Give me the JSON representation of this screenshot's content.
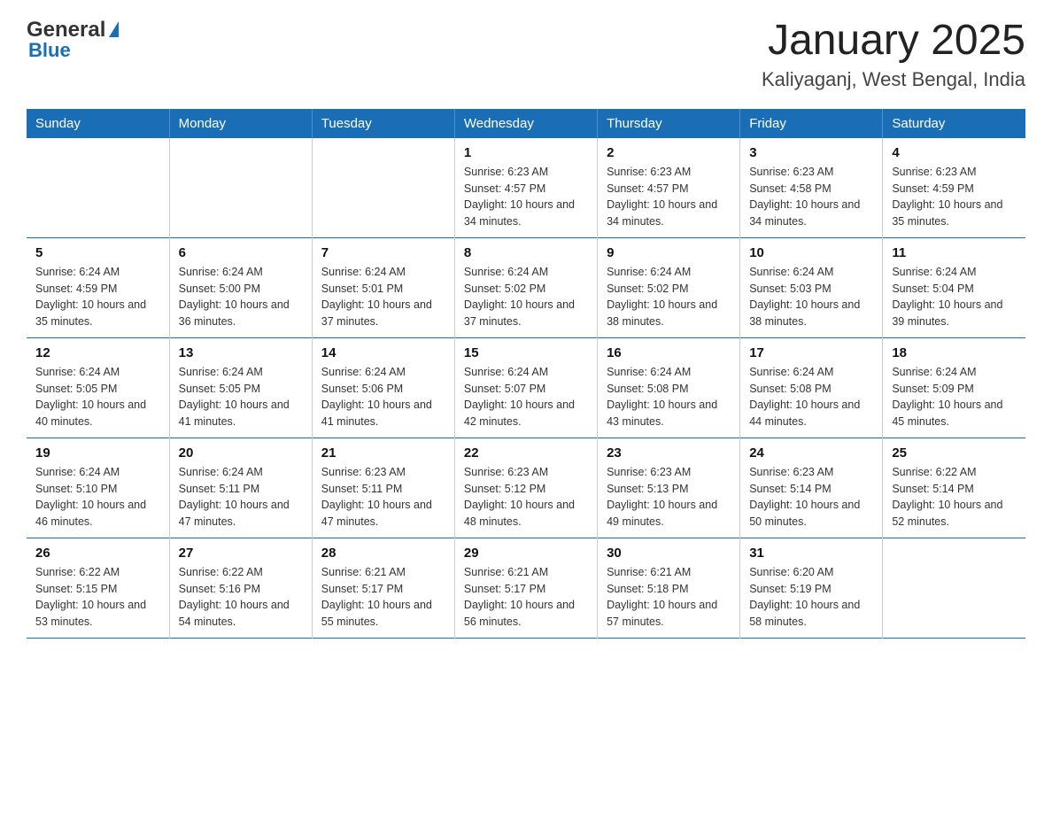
{
  "header": {
    "logo_general": "General",
    "logo_blue": "Blue",
    "title": "January 2025",
    "subtitle": "Kaliyaganj, West Bengal, India"
  },
  "days_of_week": [
    "Sunday",
    "Monday",
    "Tuesday",
    "Wednesday",
    "Thursday",
    "Friday",
    "Saturday"
  ],
  "weeks": [
    [
      {
        "day": "",
        "sunrise": "",
        "sunset": "",
        "daylight": ""
      },
      {
        "day": "",
        "sunrise": "",
        "sunset": "",
        "daylight": ""
      },
      {
        "day": "",
        "sunrise": "",
        "sunset": "",
        "daylight": ""
      },
      {
        "day": "1",
        "sunrise": "Sunrise: 6:23 AM",
        "sunset": "Sunset: 4:57 PM",
        "daylight": "Daylight: 10 hours and 34 minutes."
      },
      {
        "day": "2",
        "sunrise": "Sunrise: 6:23 AM",
        "sunset": "Sunset: 4:57 PM",
        "daylight": "Daylight: 10 hours and 34 minutes."
      },
      {
        "day": "3",
        "sunrise": "Sunrise: 6:23 AM",
        "sunset": "Sunset: 4:58 PM",
        "daylight": "Daylight: 10 hours and 34 minutes."
      },
      {
        "day": "4",
        "sunrise": "Sunrise: 6:23 AM",
        "sunset": "Sunset: 4:59 PM",
        "daylight": "Daylight: 10 hours and 35 minutes."
      }
    ],
    [
      {
        "day": "5",
        "sunrise": "Sunrise: 6:24 AM",
        "sunset": "Sunset: 4:59 PM",
        "daylight": "Daylight: 10 hours and 35 minutes."
      },
      {
        "day": "6",
        "sunrise": "Sunrise: 6:24 AM",
        "sunset": "Sunset: 5:00 PM",
        "daylight": "Daylight: 10 hours and 36 minutes."
      },
      {
        "day": "7",
        "sunrise": "Sunrise: 6:24 AM",
        "sunset": "Sunset: 5:01 PM",
        "daylight": "Daylight: 10 hours and 37 minutes."
      },
      {
        "day": "8",
        "sunrise": "Sunrise: 6:24 AM",
        "sunset": "Sunset: 5:02 PM",
        "daylight": "Daylight: 10 hours and 37 minutes."
      },
      {
        "day": "9",
        "sunrise": "Sunrise: 6:24 AM",
        "sunset": "Sunset: 5:02 PM",
        "daylight": "Daylight: 10 hours and 38 minutes."
      },
      {
        "day": "10",
        "sunrise": "Sunrise: 6:24 AM",
        "sunset": "Sunset: 5:03 PM",
        "daylight": "Daylight: 10 hours and 38 minutes."
      },
      {
        "day": "11",
        "sunrise": "Sunrise: 6:24 AM",
        "sunset": "Sunset: 5:04 PM",
        "daylight": "Daylight: 10 hours and 39 minutes."
      }
    ],
    [
      {
        "day": "12",
        "sunrise": "Sunrise: 6:24 AM",
        "sunset": "Sunset: 5:05 PM",
        "daylight": "Daylight: 10 hours and 40 minutes."
      },
      {
        "day": "13",
        "sunrise": "Sunrise: 6:24 AM",
        "sunset": "Sunset: 5:05 PM",
        "daylight": "Daylight: 10 hours and 41 minutes."
      },
      {
        "day": "14",
        "sunrise": "Sunrise: 6:24 AM",
        "sunset": "Sunset: 5:06 PM",
        "daylight": "Daylight: 10 hours and 41 minutes."
      },
      {
        "day": "15",
        "sunrise": "Sunrise: 6:24 AM",
        "sunset": "Sunset: 5:07 PM",
        "daylight": "Daylight: 10 hours and 42 minutes."
      },
      {
        "day": "16",
        "sunrise": "Sunrise: 6:24 AM",
        "sunset": "Sunset: 5:08 PM",
        "daylight": "Daylight: 10 hours and 43 minutes."
      },
      {
        "day": "17",
        "sunrise": "Sunrise: 6:24 AM",
        "sunset": "Sunset: 5:08 PM",
        "daylight": "Daylight: 10 hours and 44 minutes."
      },
      {
        "day": "18",
        "sunrise": "Sunrise: 6:24 AM",
        "sunset": "Sunset: 5:09 PM",
        "daylight": "Daylight: 10 hours and 45 minutes."
      }
    ],
    [
      {
        "day": "19",
        "sunrise": "Sunrise: 6:24 AM",
        "sunset": "Sunset: 5:10 PM",
        "daylight": "Daylight: 10 hours and 46 minutes."
      },
      {
        "day": "20",
        "sunrise": "Sunrise: 6:24 AM",
        "sunset": "Sunset: 5:11 PM",
        "daylight": "Daylight: 10 hours and 47 minutes."
      },
      {
        "day": "21",
        "sunrise": "Sunrise: 6:23 AM",
        "sunset": "Sunset: 5:11 PM",
        "daylight": "Daylight: 10 hours and 47 minutes."
      },
      {
        "day": "22",
        "sunrise": "Sunrise: 6:23 AM",
        "sunset": "Sunset: 5:12 PM",
        "daylight": "Daylight: 10 hours and 48 minutes."
      },
      {
        "day": "23",
        "sunrise": "Sunrise: 6:23 AM",
        "sunset": "Sunset: 5:13 PM",
        "daylight": "Daylight: 10 hours and 49 minutes."
      },
      {
        "day": "24",
        "sunrise": "Sunrise: 6:23 AM",
        "sunset": "Sunset: 5:14 PM",
        "daylight": "Daylight: 10 hours and 50 minutes."
      },
      {
        "day": "25",
        "sunrise": "Sunrise: 6:22 AM",
        "sunset": "Sunset: 5:14 PM",
        "daylight": "Daylight: 10 hours and 52 minutes."
      }
    ],
    [
      {
        "day": "26",
        "sunrise": "Sunrise: 6:22 AM",
        "sunset": "Sunset: 5:15 PM",
        "daylight": "Daylight: 10 hours and 53 minutes."
      },
      {
        "day": "27",
        "sunrise": "Sunrise: 6:22 AM",
        "sunset": "Sunset: 5:16 PM",
        "daylight": "Daylight: 10 hours and 54 minutes."
      },
      {
        "day": "28",
        "sunrise": "Sunrise: 6:21 AM",
        "sunset": "Sunset: 5:17 PM",
        "daylight": "Daylight: 10 hours and 55 minutes."
      },
      {
        "day": "29",
        "sunrise": "Sunrise: 6:21 AM",
        "sunset": "Sunset: 5:17 PM",
        "daylight": "Daylight: 10 hours and 56 minutes."
      },
      {
        "day": "30",
        "sunrise": "Sunrise: 6:21 AM",
        "sunset": "Sunset: 5:18 PM",
        "daylight": "Daylight: 10 hours and 57 minutes."
      },
      {
        "day": "31",
        "sunrise": "Sunrise: 6:20 AM",
        "sunset": "Sunset: 5:19 PM",
        "daylight": "Daylight: 10 hours and 58 minutes."
      },
      {
        "day": "",
        "sunrise": "",
        "sunset": "",
        "daylight": ""
      }
    ]
  ]
}
